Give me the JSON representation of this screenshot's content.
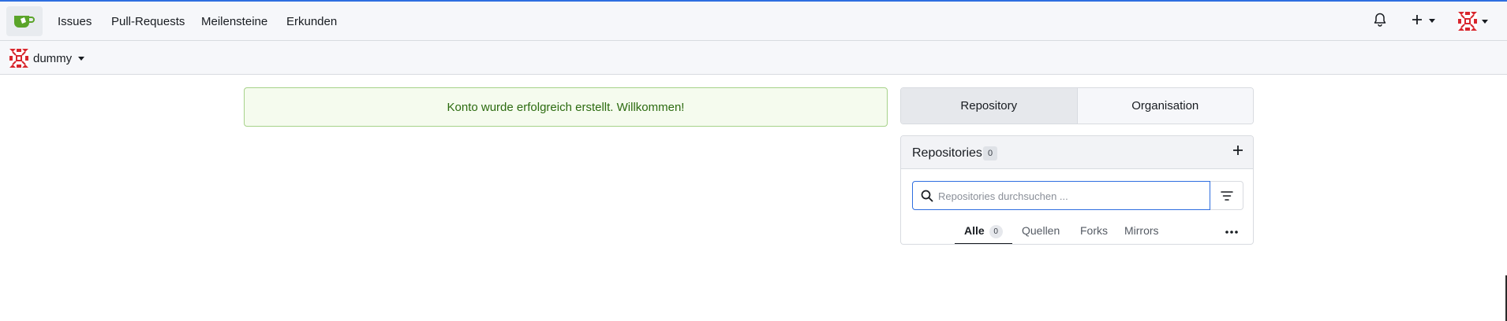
{
  "nav": {
    "logo_icon": "gitea-teacup-icon",
    "items": [
      "Issues",
      "Pull-Requests",
      "Meilensteine",
      "Erkunden"
    ],
    "notification_icon": "bell-icon",
    "create_icon": "plus-icon",
    "avatar_icon": "identicon-avatar"
  },
  "context": {
    "user_name": "dummy"
  },
  "flash": {
    "message": "Konto wurde erfolgreich erstellt. Willkommen!"
  },
  "switcher": {
    "tabs": [
      "Repository",
      "Organisation"
    ],
    "active": "Repository"
  },
  "repos": {
    "title": "Repositories",
    "count": "0",
    "search_placeholder": "Repositories durchsuchen ...",
    "filters": [
      {
        "label": "Alle",
        "badge": "0",
        "active": true
      },
      {
        "label": "Quellen"
      },
      {
        "label": "Forks"
      },
      {
        "label": "Mirrors"
      }
    ]
  },
  "colors": {
    "accent": "#2e6ee0",
    "success_bg": "#f5fbee",
    "success_text": "#2c6b10",
    "logo_green": "#5aa429",
    "avatar_red": "#d8262d"
  }
}
